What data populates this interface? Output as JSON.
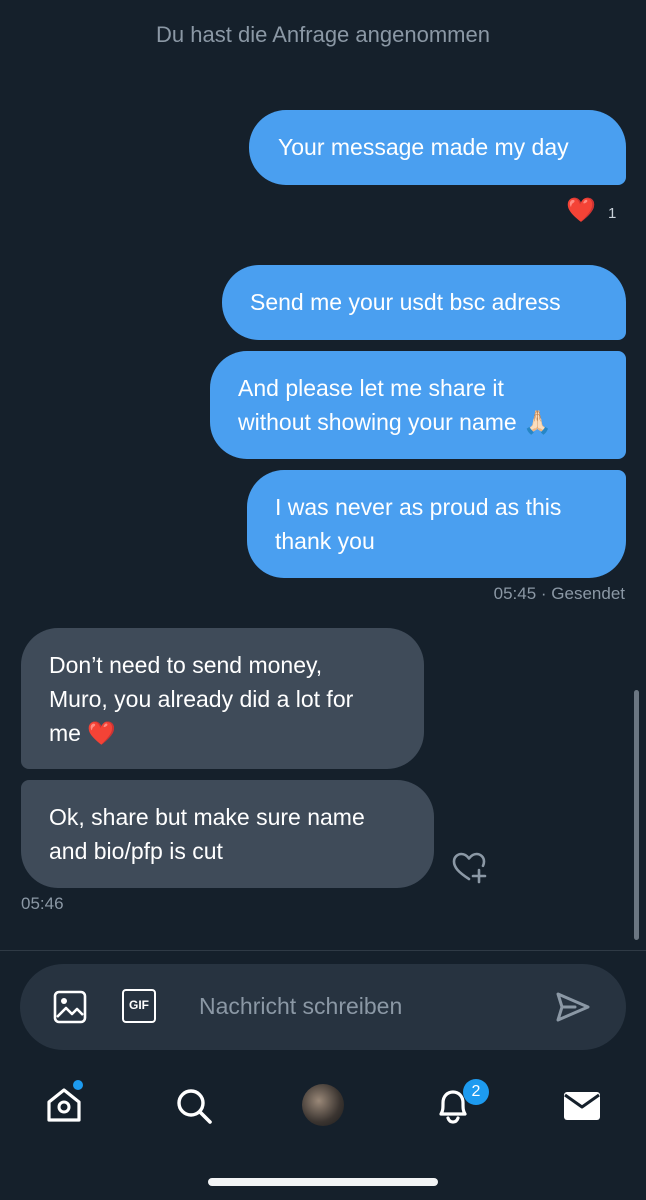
{
  "notice": "Du hast die Anfrage angenommen",
  "messages": {
    "out1": "Your message made my day",
    "out2": "Send me your usdt bsc adress",
    "out3_line1": "And please let me share it",
    "out3_line2": "without showing your name",
    "out3_emoji": "🙏🏻",
    "out4_line1": "I was never as proud as this",
    "out4_line2": "thank you",
    "in1_line1": "Don’t need to send money,",
    "in1_line2": "Muro, you already did a lot for",
    "in1_line3": "me",
    "in1_emoji": "❤️",
    "in2_line1": "Ok, share but make sure name",
    "in2_line2": "and bio/pfp is cut"
  },
  "reaction": {
    "emoji": "❤️",
    "count": "1"
  },
  "meta": {
    "sent_time": "05:45",
    "sent_status": "· Gesendet",
    "received_time": "05:46"
  },
  "composer": {
    "placeholder": "Nachricht schreiben",
    "gif_label": "GIF"
  },
  "nav": {
    "notifications_badge": "2"
  },
  "icons": {
    "image": "image-icon",
    "gif": "gif-icon",
    "send": "send-icon",
    "heart_add": "heart-plus-icon",
    "home": "home-icon",
    "search": "search-icon",
    "bell": "bell-icon",
    "mail": "mail-icon"
  },
  "colors": {
    "background": "#15202b",
    "outgoing_bubble": "#4a9ff0",
    "incoming_bubble": "#3f4b59",
    "accent": "#1d9bf0"
  }
}
